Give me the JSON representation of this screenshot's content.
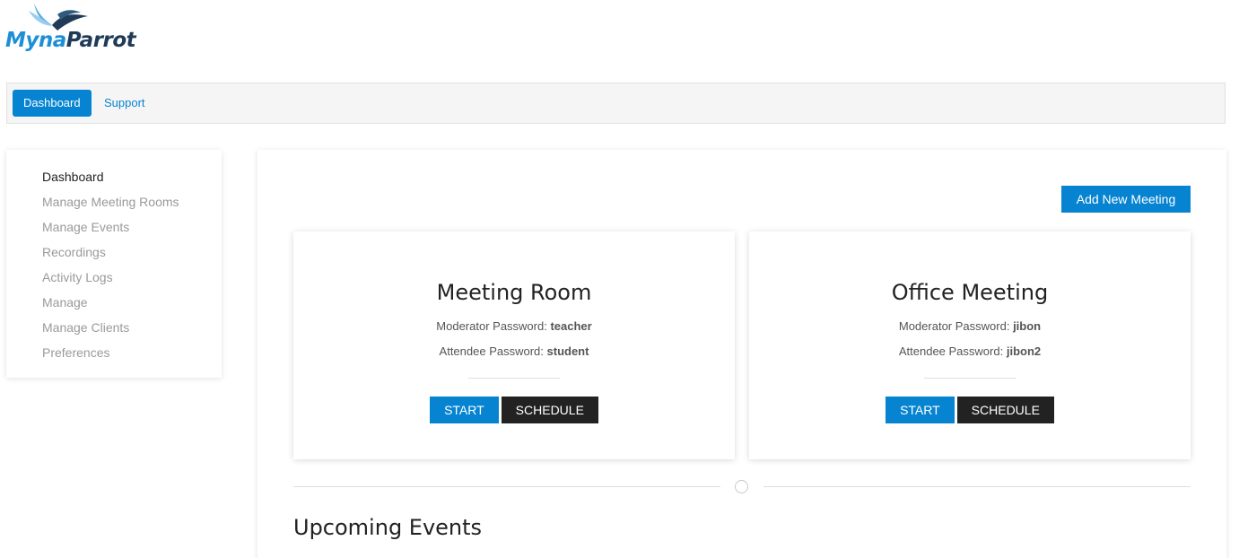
{
  "logo": {
    "part1": "Myna",
    "part2": "Parrot"
  },
  "topnav": [
    {
      "label": "Dashboard",
      "active": true
    },
    {
      "label": "Support",
      "active": false
    }
  ],
  "sidebar": {
    "items": [
      {
        "label": "Dashboard",
        "active": true
      },
      {
        "label": "Manage Meeting Rooms"
      },
      {
        "label": "Manage Events"
      },
      {
        "label": "Recordings"
      },
      {
        "label": "Activity Logs"
      },
      {
        "label": "Manage"
      },
      {
        "label": "Manage Clients"
      },
      {
        "label": "Preferences"
      }
    ]
  },
  "main": {
    "add_button": "Add New Meeting",
    "moderator_label": "Moderator Password:",
    "attendee_label": "Attendee Password:",
    "start_label": "START",
    "schedule_label": "SCHEDULE",
    "meetings": [
      {
        "title": "Meeting Room",
        "moderator_password": "teacher",
        "attendee_password": "student"
      },
      {
        "title": "Office Meeting",
        "moderator_password": "jibon",
        "attendee_password": "jibon2"
      }
    ],
    "upcoming_title": "Upcoming Events"
  },
  "colors": {
    "primary": "#0784d1",
    "dark": "#222222",
    "brand_dark": "#1f3b57"
  }
}
